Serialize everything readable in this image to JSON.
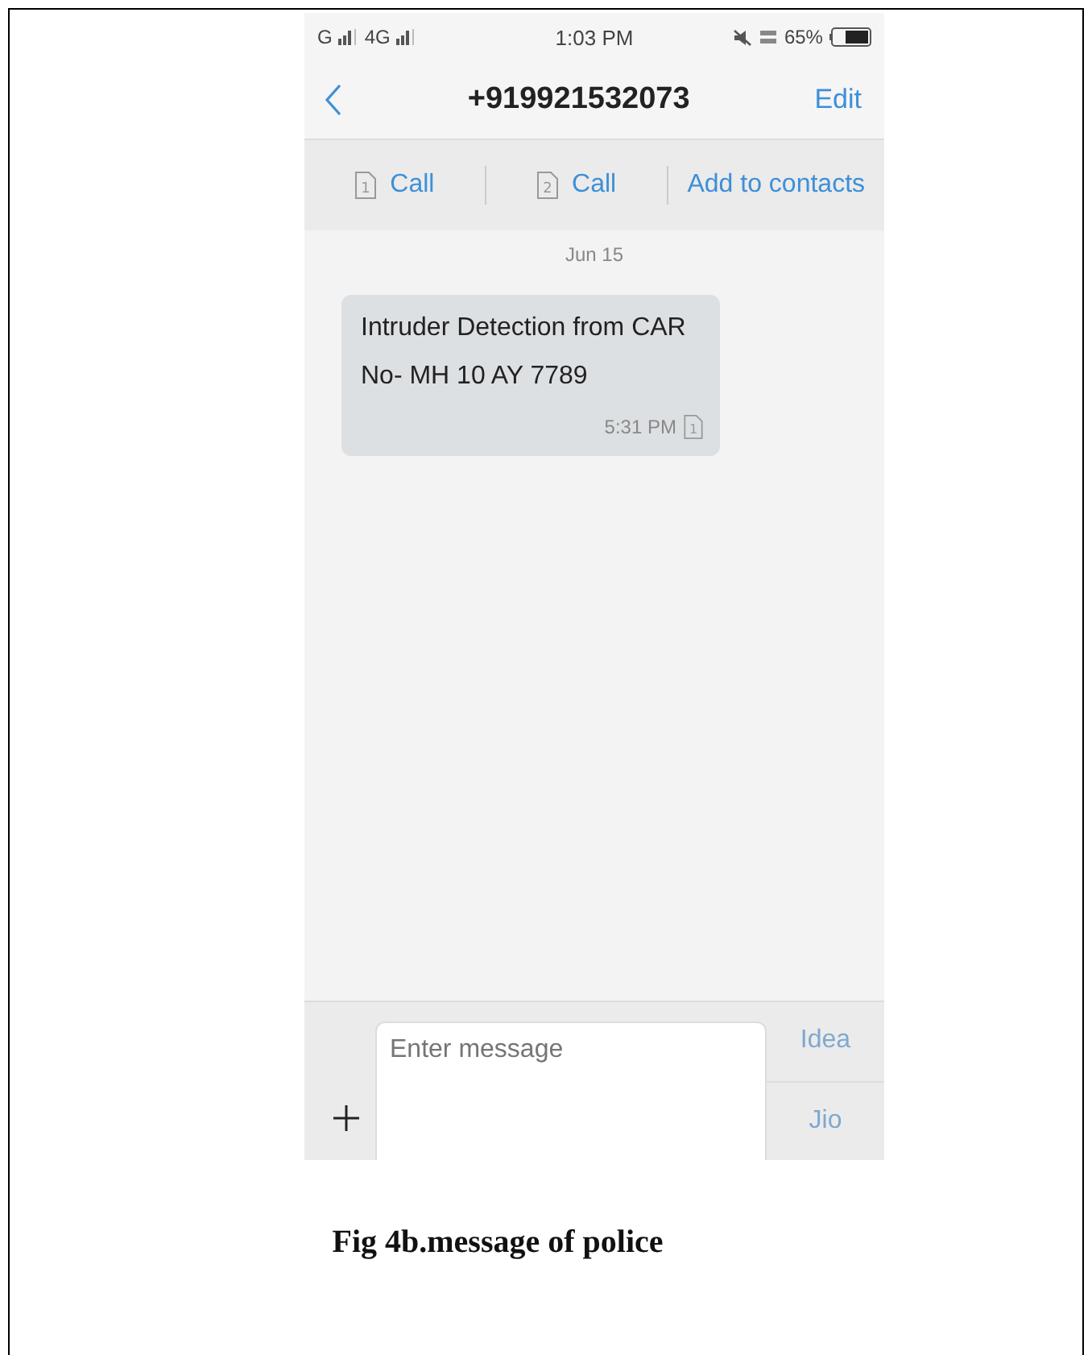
{
  "status_bar": {
    "networks": [
      {
        "label": "G"
      },
      {
        "label": "4G"
      }
    ],
    "time": "1:03 PM",
    "battery_percent": "65%"
  },
  "header": {
    "title": "+919921532073",
    "action": "Edit"
  },
  "actions": [
    {
      "sim": "1",
      "label": "Call"
    },
    {
      "sim": "2",
      "label": "Call"
    },
    {
      "label": "Add to contacts"
    }
  ],
  "messages": [
    {
      "date": "Jun 15",
      "text": "Intruder Detection from CAR No- MH 10 AY 7789",
      "time": "5:31 PM",
      "sim": "1"
    }
  ],
  "composer": {
    "placeholder": "Enter message",
    "send_buttons": [
      {
        "label": "Idea",
        "disabled": true
      },
      {
        "label": "Jio",
        "disabled": true
      }
    ]
  },
  "caption": "Fig 4b.message of police"
}
